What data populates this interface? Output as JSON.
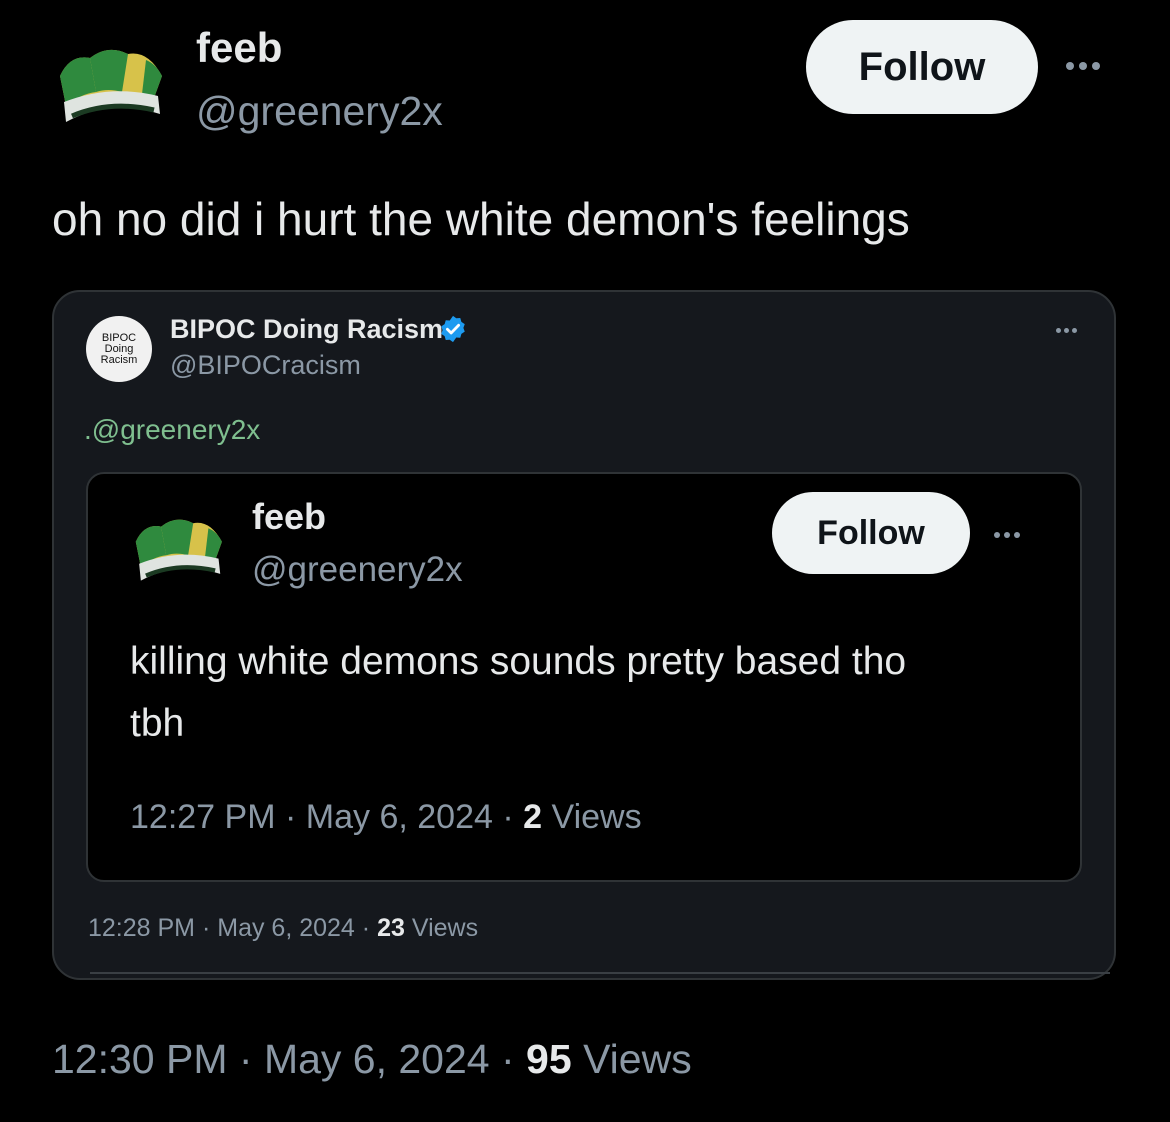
{
  "outer_tweet": {
    "author_name": "feeb",
    "author_handle": "@greenery2x",
    "follow_label": "Follow",
    "text": "oh no did i hurt the white demon's feelings",
    "time": "12:30 PM",
    "date": "May 6, 2024",
    "views_count": "95",
    "views_label": "Views"
  },
  "quoted_tweet": {
    "author_name": "BIPOC Doing Racism",
    "author_handle": "@BIPOCracism",
    "avatar_text": [
      "BIPOC",
      "Doing",
      "Racism"
    ],
    "mention": ".@greenery2x",
    "time": "12:28 PM",
    "date": "May 6, 2024",
    "views_count": "23",
    "views_label": "Views"
  },
  "inner_tweet": {
    "author_name": "feeb",
    "author_handle": "@greenery2x",
    "follow_label": "Follow",
    "text_line1": "killing white demons sounds pretty based tho",
    "text_line2": "tbh",
    "time": "12:27 PM",
    "date": "May 6, 2024",
    "views_count": "2",
    "views_label": "Views"
  },
  "colors": {
    "background": "#000000",
    "text_primary": "#e7e9ea",
    "text_secondary": "#8b98a5",
    "follow_bg": "#eff3f4",
    "verified": "#1d9bf0",
    "mention": "#7fbf8f"
  },
  "icons": [
    "jester-hat-avatar",
    "verified-badge-icon",
    "more-options-icon"
  ]
}
